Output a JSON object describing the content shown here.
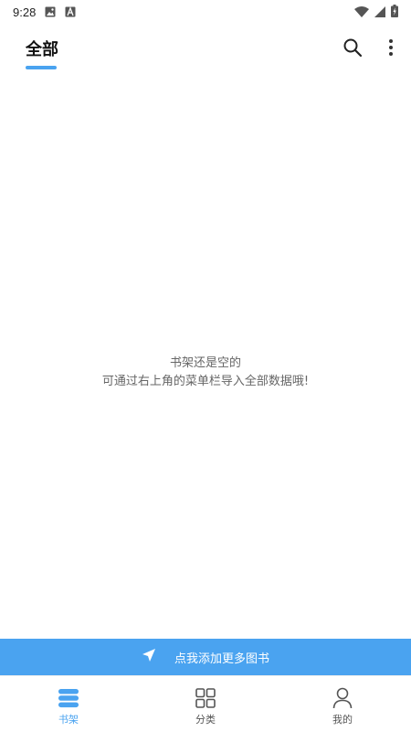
{
  "status_bar": {
    "time": "9:28",
    "icons": [
      "image-notification-icon",
      "a-notification-icon",
      "wifi-icon",
      "cell-signal-icon",
      "battery-charging-icon"
    ]
  },
  "header": {
    "tab_label": "全部",
    "search_icon": "search-icon",
    "more_icon": "more-vertical-icon"
  },
  "empty_state": {
    "line1": "书架还是空的",
    "line2": "可通过右上角的菜单栏导入全部数据哦!"
  },
  "add_banner": {
    "label": "点我添加更多图书",
    "icon": "send-icon"
  },
  "bottom_nav": {
    "items": [
      {
        "label": "书架",
        "icon": "bookshelf-icon",
        "active": true
      },
      {
        "label": "分类",
        "icon": "grid-icon",
        "active": false
      },
      {
        "label": "我的",
        "icon": "person-icon",
        "active": false
      }
    ]
  },
  "colors": {
    "accent": "#4aa3f0",
    "text_primary": "#111111",
    "text_secondary": "#666666"
  }
}
